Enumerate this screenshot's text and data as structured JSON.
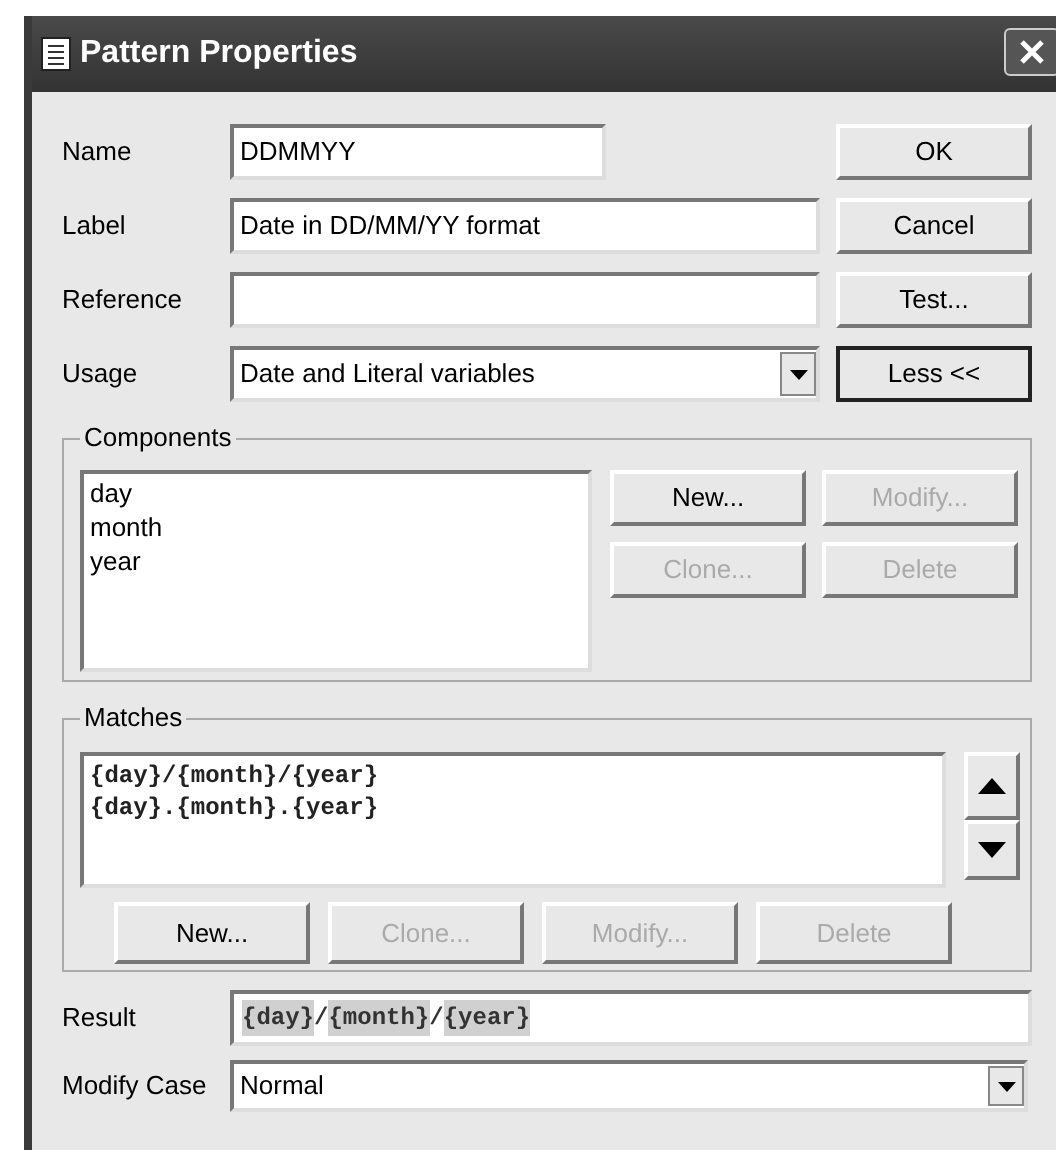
{
  "window": {
    "title": "Pattern Properties"
  },
  "fields": [
    {
      "label": "Name",
      "kind": "short",
      "value": "DDMMYY"
    },
    {
      "label": "Label",
      "kind": "text",
      "value": "Date in DD/MM/YY format"
    },
    {
      "label": "Reference",
      "kind": "text"
    },
    {
      "label": "Usage",
      "kind": "dropdown",
      "value": "Date and Literal variables"
    }
  ],
  "side_buttons": [
    {
      "label": "OK",
      "default": false
    },
    {
      "label": "Cancel",
      "default": false
    },
    {
      "label": "Test...",
      "default": false
    },
    {
      "label": "Less <<",
      "default": true
    }
  ],
  "components": {
    "title": "Components",
    "items": [
      "day",
      "month",
      "year"
    ],
    "buttons": [
      {
        "label": "New...",
        "disabled": false
      },
      {
        "label": "Modify...",
        "disabled": true
      },
      {
        "label": "Clone...",
        "disabled": true
      },
      {
        "label": "Delete",
        "disabled": true
      }
    ]
  },
  "matches": {
    "title": "Matches",
    "items": [
      "{day}/{month}/{year}",
      "{day}.{month}.{year}"
    ],
    "buttons": [
      {
        "label": "New...",
        "disabled": false
      },
      {
        "label": "Clone...",
        "disabled": true
      },
      {
        "label": "Modify...",
        "disabled": true
      },
      {
        "label": "Delete",
        "disabled": true
      }
    ]
  },
  "result": {
    "label": "Result",
    "segments": [
      {
        "kind": "token",
        "text": "{day}"
      },
      {
        "kind": "text",
        "text": "/"
      },
      {
        "kind": "token",
        "text": "{month}"
      },
      {
        "kind": "text",
        "text": "/"
      },
      {
        "kind": "token",
        "text": "{year}"
      }
    ]
  },
  "modify_case": {
    "label": "Modify Case",
    "value": "Normal"
  }
}
